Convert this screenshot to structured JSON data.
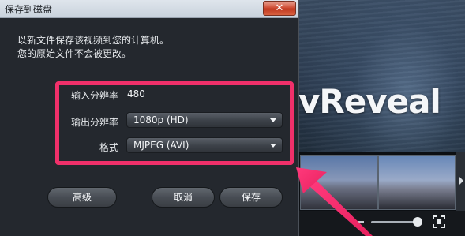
{
  "dialog": {
    "title": "保存到磁盘",
    "close_label": "✕",
    "description_line1": "以新文件保存该视频到您的计算机。",
    "description_line2": "您的原始文件不会被更改。",
    "input_resolution_label": "输入分辨率",
    "input_resolution_value": "480",
    "output_resolution_label": "输出分辨率",
    "output_resolution_value": "1080p (HD)",
    "format_label": "格式",
    "format_value": "MJPEG (AVI)",
    "advanced_label": "高级",
    "cancel_label": "取消",
    "save_label": "保存"
  },
  "background_app": {
    "logo_text": "vReveal"
  },
  "colors": {
    "highlight": "#f0306a",
    "dialog_bg": "#24282e",
    "titlebar": "#dfe5ec",
    "close_button": "#d05038"
  },
  "icons": {
    "close": "close-icon",
    "dropdown": "chevron-down-icon",
    "fullscreen": "fullscreen-icon",
    "annotation": "arrow-icon"
  }
}
